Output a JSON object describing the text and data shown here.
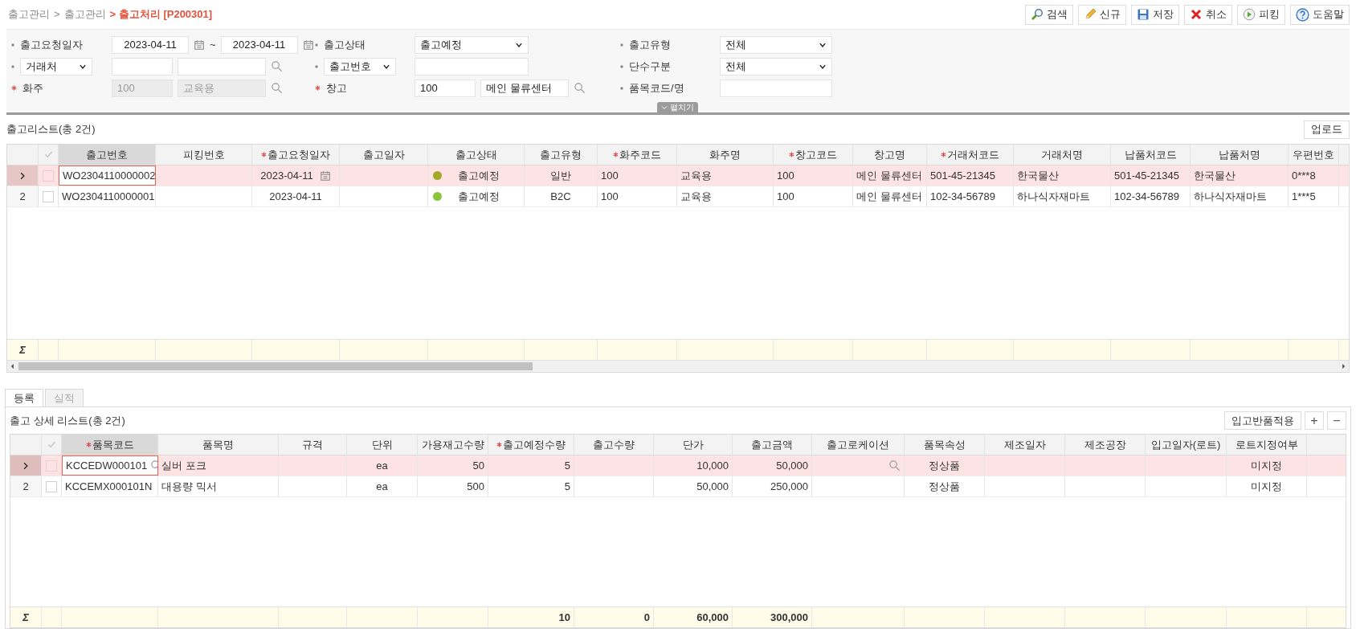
{
  "breadcrumb": [
    {
      "text": "출고관리",
      "current": false
    },
    {
      "text": ">",
      "current": false
    },
    {
      "text": "출고관리",
      "current": false
    },
    {
      "text": "> 출고처리 [P200301]",
      "current": true
    }
  ],
  "toolbar": [
    {
      "label": "검색"
    },
    {
      "label": "신규"
    },
    {
      "label": "저장"
    },
    {
      "label": "취소"
    },
    {
      "label": "피킹"
    },
    {
      "label": "도움말"
    }
  ],
  "filters": [
    {
      "label": "출고요청일자",
      "required": false,
      "kind": "daterange",
      "from": "2023-04-11",
      "separator": "~",
      "to": "2023-04-11"
    },
    {
      "label": "출고상태",
      "required": false,
      "kind": "select",
      "value": "출고예정"
    },
    {
      "label": "출고유형",
      "required": false,
      "kind": "select",
      "value": "전체"
    },
    {
      "label": "거래처",
      "label_select": true,
      "required": false,
      "kind": "lookup",
      "disabled": false
    },
    {
      "label": "출고번호",
      "label_select": true,
      "required": false,
      "kind": "text"
    },
    {
      "label": "단수구분",
      "required": false,
      "kind": "select",
      "value": "전체"
    },
    {
      "label": "화주",
      "required": true,
      "kind": "lookup",
      "code": "100",
      "name": "교육용",
      "disabled": true
    },
    {
      "label": "창고",
      "required": true,
      "kind": "lookup",
      "code": "100",
      "name": "메인 물류센터",
      "disabled": false
    },
    {
      "label": "품목코드/명",
      "required": false,
      "kind": "text"
    }
  ],
  "expand_toggle": {
    "label": "펼치기"
  },
  "list": {
    "title": "출고리스트(총 2건)",
    "button": "업로드",
    "sum_label": "Σ",
    "columns": [
      {
        "label": "출고번호",
        "required": false,
        "highlighted": true
      },
      {
        "label": "피킹번호",
        "required": false
      },
      {
        "label": "출고요청일자",
        "required": true
      },
      {
        "label": "출고일자",
        "required": false
      },
      {
        "label": "출고상태",
        "required": false
      },
      {
        "label": "출고유형",
        "required": false
      },
      {
        "label": "화주코드",
        "required": true
      },
      {
        "label": "화주명",
        "required": false
      },
      {
        "label": "창고코드",
        "required": true
      },
      {
        "label": "창고명",
        "required": false
      },
      {
        "label": "거래처코드",
        "required": true
      },
      {
        "label": "거래처명",
        "required": false
      },
      {
        "label": "납품처코드",
        "required": false
      },
      {
        "label": "납품처명",
        "required": false
      },
      {
        "label": "우편번호",
        "required": false
      }
    ],
    "rows": [
      {
        "selected": true,
        "focused": true,
        "checked": false,
        "color": "#a3a82a",
        "cells": [
          "WO2304110000002",
          null,
          "2023-04-11",
          null,
          "출고예정",
          "일반",
          "100",
          "교육용",
          "100",
          "메인 물류센터",
          "501-45-21345",
          "한국물산",
          "501-45-21345",
          "한국물산",
          "0***8"
        ]
      },
      {
        "selected": false,
        "focused": false,
        "number": "2",
        "checked": false,
        "color": "#8cc43c",
        "cells": [
          "WO2304110000001",
          null,
          "2023-04-11",
          null,
          "출고예정",
          "B2C",
          "100",
          "교육용",
          "100",
          "메인 물류센터",
          "102-34-56789",
          "하나식자재마트",
          "102-34-56789",
          "하나식자재마트",
          "1***5"
        ]
      }
    ]
  },
  "tabs": [
    {
      "label": "등록",
      "selected": true
    },
    {
      "label": "실적",
      "selected": false
    }
  ],
  "detail": {
    "title": "출고 상세 리스트(총 2건)",
    "buttons": [
      {
        "label": "입고반품적용",
        "kind": "text"
      },
      {
        "label": "+",
        "kind": "icon"
      },
      {
        "label": "−",
        "kind": "icon"
      }
    ],
    "sum_label": "Σ",
    "columns": [
      {
        "label": "품목코드",
        "required": true,
        "highlighted": true
      },
      {
        "label": "품목명",
        "required": false
      },
      {
        "label": "규격",
        "required": false
      },
      {
        "label": "단위",
        "required": false
      },
      {
        "label": "가용재고수량",
        "required": false
      },
      {
        "label": "출고예정수량",
        "required": true,
        "sum": "10"
      },
      {
        "label": "출고수량",
        "required": false,
        "sum": "0"
      },
      {
        "label": "단가",
        "required": false,
        "sum": "60,000"
      },
      {
        "label": "출고금액",
        "required": false,
        "sum": "300,000"
      },
      {
        "label": "출고로케이션",
        "required": false
      },
      {
        "label": "품목속성",
        "required": false
      },
      {
        "label": "제조일자",
        "required": false
      },
      {
        "label": "제조공장",
        "required": false
      },
      {
        "label": "입고일자(로트)",
        "required": false
      },
      {
        "label": "로트지정여부",
        "required": false
      }
    ],
    "rows": [
      {
        "selected": true,
        "focused": true,
        "checked": false,
        "cells": [
          "KCCEDW000101",
          "실버 포크",
          null,
          "ea",
          "50",
          "5",
          null,
          "10,000",
          "50,000",
          null,
          "정상품",
          null,
          null,
          null,
          "미지정"
        ]
      },
      {
        "selected": false,
        "focused": false,
        "number": "2",
        "checked": false,
        "cells": [
          "KCCEMX000101N",
          "대용량 믹서",
          null,
          "ea",
          "500",
          "5",
          null,
          "50,000",
          "250,000",
          null,
          "정상품",
          null,
          null,
          null,
          "미지정"
        ]
      }
    ]
  }
}
